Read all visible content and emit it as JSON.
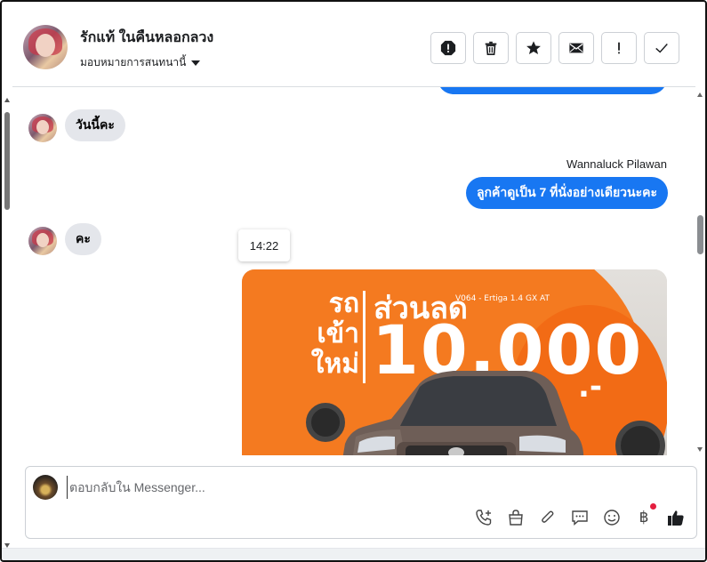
{
  "header": {
    "contact_name": "รักแท้ ในคืนหลอกลวง",
    "assign_label": "มอบหมายการสนทนานี้",
    "actions": [
      {
        "name": "spam-button",
        "icon": "alert-octagon-icon"
      },
      {
        "name": "delete-button",
        "icon": "trash-icon"
      },
      {
        "name": "star-button",
        "icon": "star-icon"
      },
      {
        "name": "mark-unread-button",
        "icon": "envelope-icon"
      },
      {
        "name": "follow-up-button",
        "icon": "exclamation-icon"
      },
      {
        "name": "mark-done-button",
        "icon": "check-icon"
      }
    ]
  },
  "messages": {
    "incoming_1": "วันนี้คะ",
    "outgoing_sender": "Wannaluck Pilawan",
    "outgoing_1": "ลูกค้าดูเป็น 7 ที่นั่งอย่างเดียวนะคะ",
    "incoming_2": "คะ",
    "timestamp": "14:22",
    "photo": {
      "promo_line_1": "รถ",
      "promo_line_2": "เข้า",
      "promo_line_3": "ใหม่",
      "discount_label": "ส่วนลด",
      "model_code": "V064 - Ertiga 1.4 GX AT",
      "amount": "10,000",
      "suffix": ".-"
    }
  },
  "composer": {
    "placeholder": "ตอบกลับใน Messenger...",
    "tools": [
      "phone-add-icon",
      "shopping-bag-icon",
      "paperclip-icon",
      "chat-bubble-icon",
      "emoji-icon",
      "baht-icon",
      "like-icon"
    ],
    "baht_symbol": "฿"
  },
  "colors": {
    "accent": "#1877f2",
    "incoming_bubble": "#e4e6eb",
    "promo_orange": "#f47a20",
    "notification_dot": "#e41e3f"
  }
}
